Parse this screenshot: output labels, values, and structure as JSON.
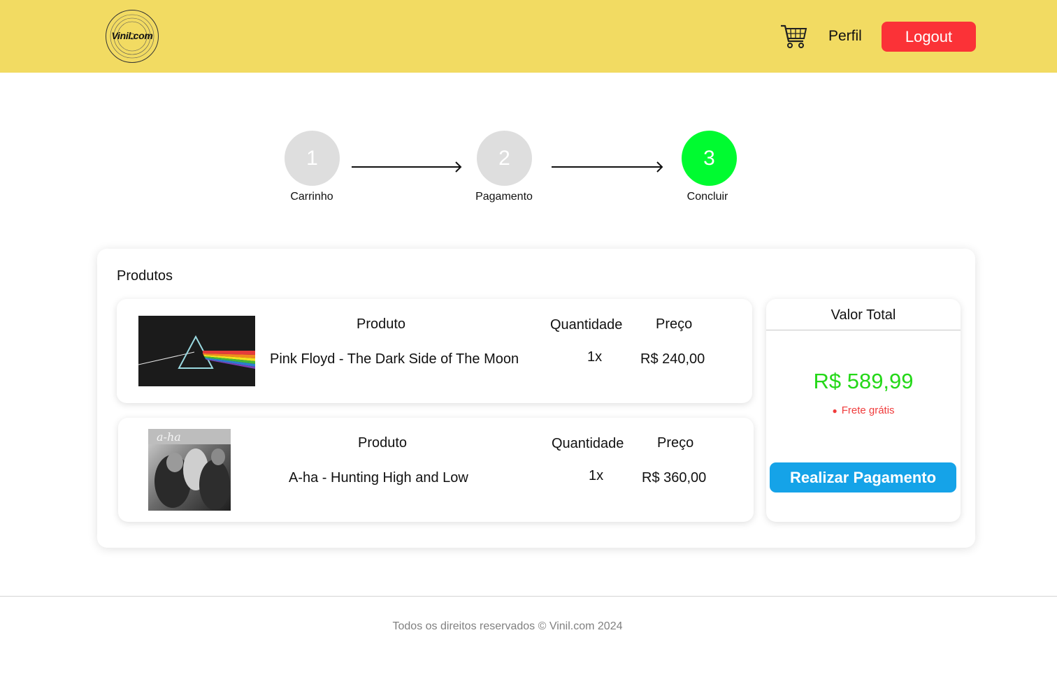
{
  "header": {
    "logo_text": "Vinil.com",
    "perfil_label": "Perfil",
    "logout_label": "Logout",
    "colors": {
      "background": "#f2db62",
      "logout": "#fb3237"
    }
  },
  "steps": [
    {
      "number": "1",
      "label": "Carrinho",
      "state": "inactive"
    },
    {
      "number": "2",
      "label": "Pagamento",
      "state": "inactive"
    },
    {
      "number": "3",
      "label": "Concluir",
      "state": "active"
    }
  ],
  "step_colors": {
    "inactive": "#dedede",
    "active": "#00fb30"
  },
  "products_section": {
    "title": "Produtos",
    "items": [
      {
        "head_product": "Produto",
        "head_quantity": "Quantidade",
        "head_price": "Preço",
        "name": "Pink Floyd - The Dark Side of The Moon",
        "quantity": "1x",
        "price": "R$ 240,00"
      },
      {
        "head_product": "Produto",
        "head_quantity": "Quantidade",
        "head_price": "Preço",
        "name": "A-ha - Hunting High and Low",
        "quantity": "1x",
        "price": "R$ 360,00"
      }
    ]
  },
  "summary": {
    "title": "Valor Total",
    "total": "R$ 589,99",
    "shipping_note": "Frete grátis",
    "pay_button": "Realizar Pagamento",
    "colors": {
      "total": "#24d818",
      "shipping": "#f03c3c",
      "button": "#15a3e8"
    }
  },
  "footer": {
    "text": "Todos os direitos reservados © Vinil.com 2024"
  }
}
